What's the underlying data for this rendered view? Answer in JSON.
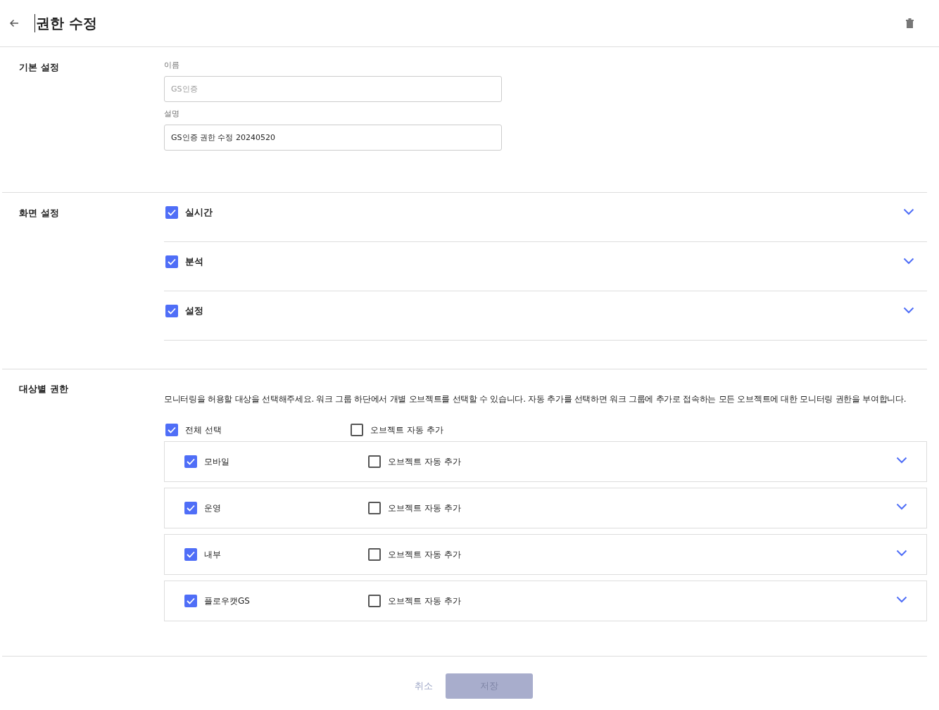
{
  "header": {
    "title": "권한 수정"
  },
  "basic": {
    "heading": "기본 설정",
    "fields": [
      {
        "label": "이름",
        "value": "GS인증",
        "disabled": true
      },
      {
        "label": "설명",
        "value": "GS인증 권한 수정 20240520",
        "disabled": false
      }
    ]
  },
  "screens": {
    "heading": "화면 설정",
    "items": [
      {
        "label": "실시간",
        "checked": true,
        "expanded": false
      },
      {
        "label": "분석",
        "checked": true,
        "expanded": false
      },
      {
        "label": "설정",
        "checked": true,
        "expanded": false
      }
    ]
  },
  "targets": {
    "heading": "대상별 권한",
    "description": "모니터링을 허용할 대상을 선택해주세요. 워크 그룹 하단에서 개별 오브젝트를 선택할 수 있습니다. 자동 추가를 선택하면 워크 그룹에 추가로 접속하는 모든 오브젝트에 대한 모니터링 권한을 부여합니다.",
    "select_all": {
      "label": "전체 선택",
      "checked": true
    },
    "auto_all": {
      "label": "오브젝트 자동 추가",
      "checked": false
    },
    "groups": [
      {
        "label": "모바일",
        "checked": true,
        "auto_label": "오브젝트 자동 추가",
        "auto": false,
        "expanded": false
      },
      {
        "label": "운영",
        "checked": true,
        "auto_label": "오브젝트 자동 추가",
        "auto": false,
        "expanded": false
      },
      {
        "label": "내부",
        "checked": true,
        "auto_label": "오브젝트 자동 추가",
        "auto": false,
        "expanded": false
      },
      {
        "label": "플로우캣GS",
        "checked": true,
        "auto_label": "오브젝트 자동 추가",
        "auto": false,
        "expanded": false
      }
    ]
  },
  "footer": {
    "cancel": "취소",
    "save": "저장",
    "save_disabled": true
  }
}
